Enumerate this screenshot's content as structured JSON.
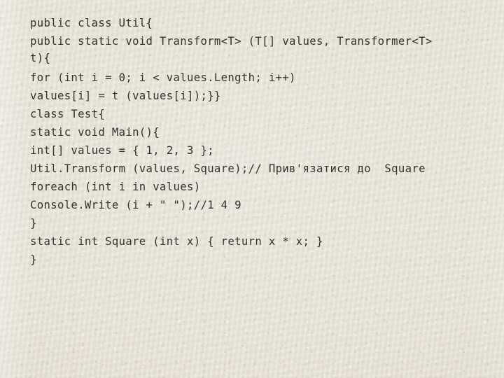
{
  "slide": {
    "kind": "code-listing",
    "background_color": "#e9e4d8",
    "text_color": "#35322c",
    "language": "C#"
  },
  "code": {
    "lines": [
      {
        "id": "line-1",
        "text": "public class Util{"
      },
      {
        "id": "line-2",
        "text": "public static void Transform<T> (T[] values, Transformer<T>"
      },
      {
        "id": "line-2-continued",
        "text": "t){"
      },
      {
        "id": "line-3",
        "text": "for (int i = 0; i < values.Length; i++)"
      },
      {
        "id": "line-4",
        "text": "values[i] = t (values[i]);}}"
      },
      {
        "id": "line-5",
        "text": "class Test{"
      },
      {
        "id": "line-6",
        "text": "static void Main(){"
      },
      {
        "id": "line-7",
        "text": "int[] values = { 1, 2, 3 };"
      },
      {
        "id": "line-8",
        "text": "Util.Transform (values, Square);// Прив'язатися до  Square"
      },
      {
        "id": "line-9",
        "text": "foreach (int i in values)"
      },
      {
        "id": "line-10",
        "text": "Console.Write (i + \" \");//1 4 9"
      },
      {
        "id": "line-11",
        "text": "}"
      },
      {
        "id": "line-12",
        "text": "static int Square (int x) { return x * x; }"
      },
      {
        "id": "line-13",
        "text": "}"
      }
    ]
  }
}
